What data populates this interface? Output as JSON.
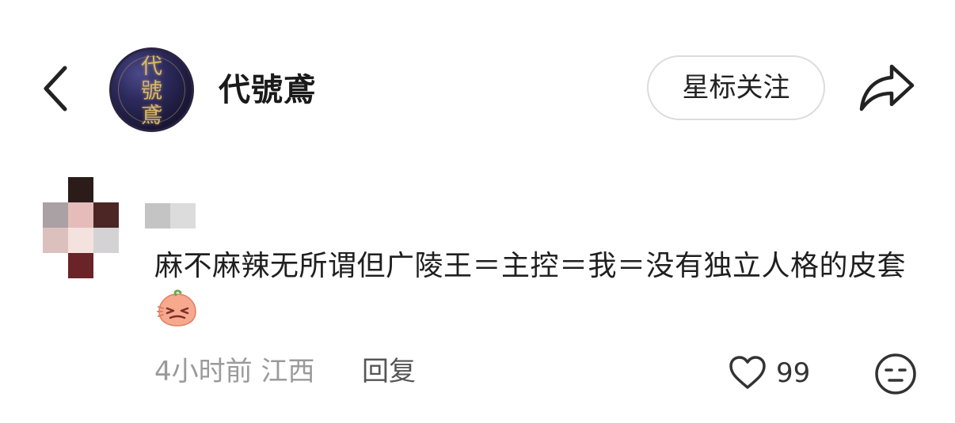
{
  "header": {
    "account_name": "代號鳶",
    "avatar_text": "代號鳶",
    "star_follow_label": "星标关注"
  },
  "comment": {
    "text": "麻不麻辣无所谓但广陵王＝主控＝我＝没有独立人格的皮套",
    "meta_time": "4小时前",
    "meta_location": "江西",
    "reply_label": "回复",
    "like_count": "99"
  },
  "icons": {
    "back": "chevron-left-icon",
    "share": "share-arrow-icon",
    "like": "heart-outline-icon",
    "dislike": "meh-face-icon",
    "emoji": "peach-sob-emoji"
  },
  "colors": {
    "text_primary": "#1f1f1f",
    "text_meta": "#9a9a9a",
    "button_border": "#dcdcdc"
  }
}
